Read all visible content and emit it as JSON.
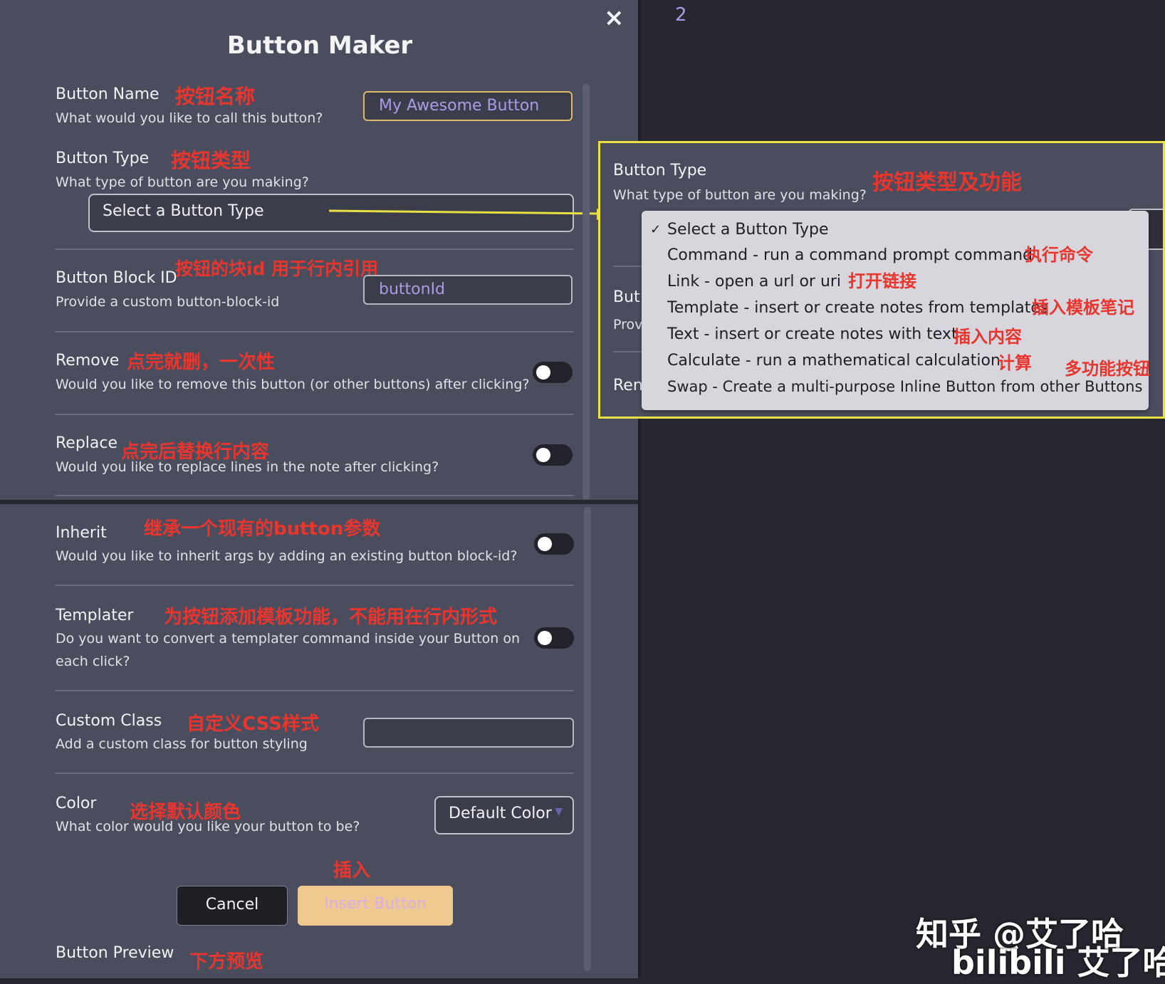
{
  "editor": {
    "line_number": "2"
  },
  "modal": {
    "title": "Button Maker",
    "close_glyph": "×",
    "fields": {
      "name": {
        "label": "Button Name",
        "desc": "What would you like to call this button?",
        "ann": "按钮名称",
        "value": "My Awesome Button"
      },
      "type": {
        "label": "Button Type",
        "desc": "What type of button are you making?",
        "ann": "按钮类型",
        "value": "Select a Button Type"
      },
      "block_id": {
        "label": "Button Block ID",
        "desc": "Provide a custom button-block-id",
        "ann": "按钮的块id 用于行内引用",
        "value": "buttonId"
      },
      "remove": {
        "label": "Remove",
        "desc": "Would you like to remove this button (or other buttons) after clicking?",
        "ann": "点完就删，一次性"
      },
      "replace": {
        "label": "Replace",
        "desc": "Would you like to replace lines in the note after clicking?",
        "ann": "点完后替换行内容"
      },
      "inherit": {
        "label": "Inherit",
        "desc": "Would you like to inherit args by adding an existing button block-id?",
        "ann": "继承一个现有的button参数"
      },
      "templater": {
        "label": "Templater",
        "desc1": "Do you want to convert a templater command inside your Button on",
        "desc2": "each click?",
        "ann": "为按钮添加模板功能，不能用在行内形式"
      },
      "custom_class": {
        "label": "Custom Class",
        "desc": "Add a custom class for button styling",
        "ann": "自定义CSS样式",
        "value": ""
      },
      "color": {
        "label": "Color",
        "desc": "What color would you like your button to be?",
        "ann": "选择默认颜色",
        "value": "Default Color"
      }
    },
    "insert_ann": "插入",
    "cancel_label": "Cancel",
    "insert_label": "Insert Button",
    "preview": {
      "label": "Button Preview",
      "ann": "下方预览"
    }
  },
  "callout": {
    "label": "Button Type",
    "desc": "What type of button are you making?",
    "ann": "按钮类型及功能",
    "cut_labels": {
      "a": "But",
      "b": "Prov",
      "c": "Ren"
    },
    "options": [
      {
        "text": "Select a Button Type",
        "checked": "✓",
        "ann": ""
      },
      {
        "text": "Command - run a command prompt command",
        "checked": "",
        "ann": "执行命令"
      },
      {
        "text": "Link - open a url or uri",
        "checked": "",
        "ann": "打开链接"
      },
      {
        "text": "Template - insert or create notes from templates",
        "checked": "",
        "ann": "插入模板笔记"
      },
      {
        "text": "Text - insert or create notes with text",
        "checked": "",
        "ann": "插入内容"
      },
      {
        "text": "Calculate - run a mathematical calculation",
        "checked": "",
        "ann": "计算"
      },
      {
        "text": "Swap - Create a multi-purpose Inline Button from other Buttons",
        "checked": "",
        "ann": "多功能按钮"
      }
    ]
  },
  "watermark": {
    "line1": "知乎 @艾了哈",
    "line2": "bilibili 艾了哈"
  }
}
